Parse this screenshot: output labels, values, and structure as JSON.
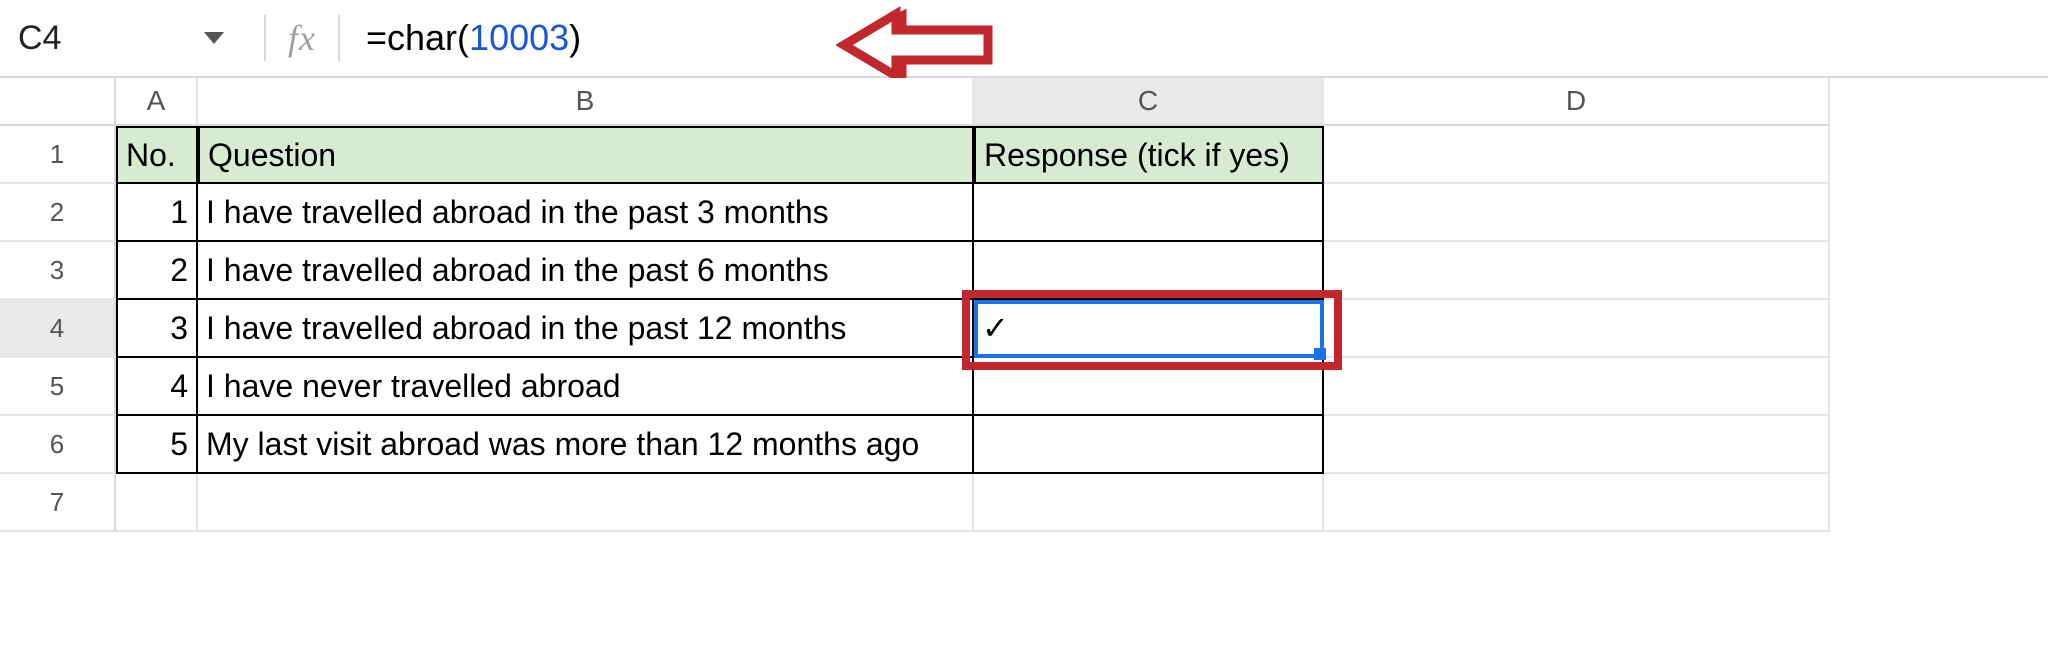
{
  "namebox": {
    "ref": "C4"
  },
  "formula": {
    "prefix": "=",
    "fn": "char",
    "open_paren": "(",
    "arg": "10003",
    "close_paren": ")"
  },
  "columns": [
    "A",
    "B",
    "C",
    "D"
  ],
  "row_numbers": [
    "1",
    "2",
    "3",
    "4",
    "5",
    "6",
    "7"
  ],
  "table": {
    "headers": {
      "no": "No.",
      "question": "Question",
      "response": "Response (tick if yes)"
    },
    "rows": [
      {
        "no": "1",
        "question": "I have travelled abroad in the past 3 months",
        "response": ""
      },
      {
        "no": "2",
        "question": "I have travelled abroad in the past 6 months",
        "response": ""
      },
      {
        "no": "3",
        "question": "I have travelled abroad in the past 12 months",
        "response": "✓"
      },
      {
        "no": "4",
        "question": "I have never travelled abroad",
        "response": ""
      },
      {
        "no": "5",
        "question": "My last visit abroad was more than 12 months ago",
        "response": ""
      }
    ]
  },
  "selection": {
    "cell": "C4"
  },
  "annotation": {
    "type": "arrow",
    "color": "#c1272d",
    "points_to": "formula-bar"
  }
}
